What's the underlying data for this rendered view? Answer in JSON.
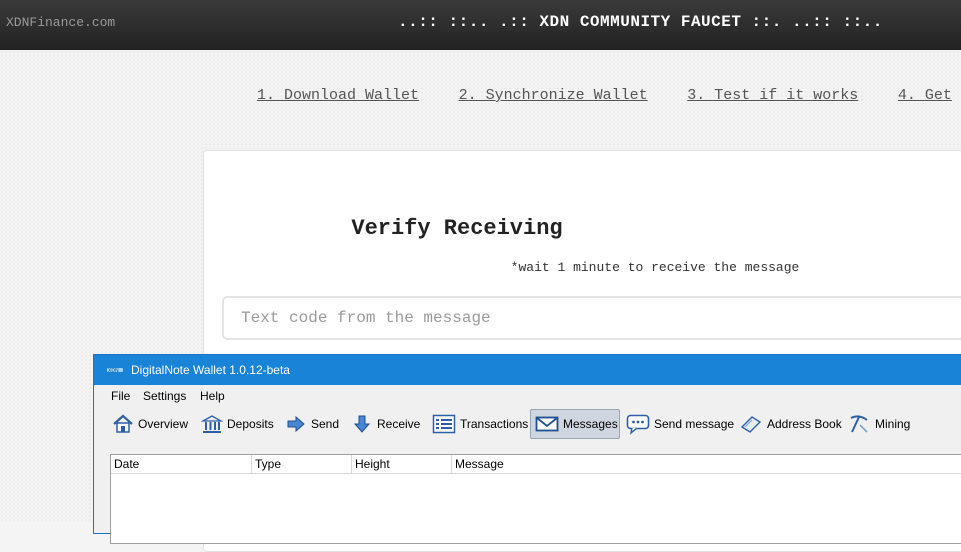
{
  "site": {
    "brand": "XDNFinance.com",
    "faucet_title": "..:: ::.. .:: XDN COMMUNITY FAUCET ::. ..:: ::.."
  },
  "steps": [
    {
      "label": "1. Download Wallet"
    },
    {
      "label": "2. Synchronize Wallet"
    },
    {
      "label": "3. Test if it works"
    },
    {
      "label": "4. Get"
    }
  ],
  "verify": {
    "title": "Verify Receiving",
    "subtitle": "*wait 1 minute to receive the message",
    "code_placeholder": "Text code from the message",
    "code_value": ""
  },
  "wallet": {
    "title": "DigitalNote Wallet 1.0.12-beta",
    "menu": [
      {
        "label": "File"
      },
      {
        "label": "Settings"
      },
      {
        "label": "Help"
      }
    ],
    "toolbar": [
      {
        "label": "Overview",
        "icon": "home-icon"
      },
      {
        "label": "Deposits",
        "icon": "bank-icon"
      },
      {
        "label": "Send",
        "icon": "send-arrow-icon"
      },
      {
        "label": "Receive",
        "icon": "receive-arrow-icon"
      },
      {
        "label": "Transactions",
        "icon": "list-icon"
      },
      {
        "label": "Messages",
        "icon": "envelope-icon",
        "active": true
      },
      {
        "label": "Send message",
        "icon": "chat-bubble-icon"
      },
      {
        "label": "Address Book",
        "icon": "address-book-icon"
      },
      {
        "label": "Mining",
        "icon": "pickaxe-icon"
      }
    ],
    "table_columns": [
      {
        "label": "Date"
      },
      {
        "label": "Type"
      },
      {
        "label": "Height"
      },
      {
        "label": "Message"
      }
    ],
    "rows": []
  },
  "colors": {
    "header_bg": "#2b2b2b",
    "wallet_titlebar": "#1883d7",
    "active_tab_bg": "#cfd6e0"
  }
}
